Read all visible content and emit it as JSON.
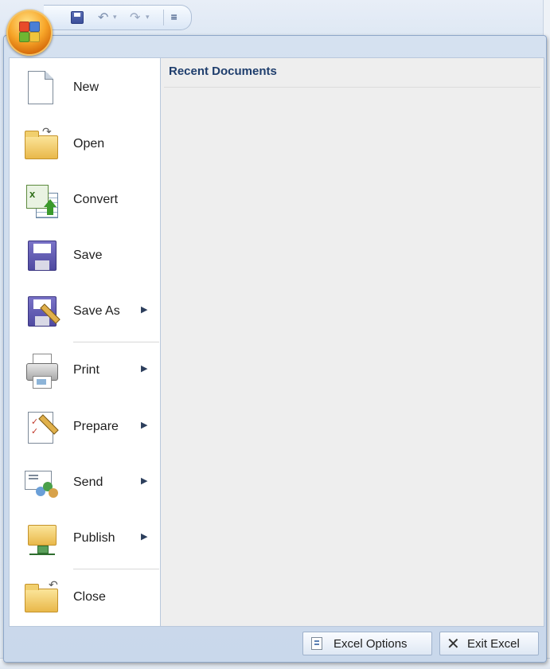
{
  "quick_access": {
    "icons": [
      "save-icon",
      "undo-icon",
      "undo-dropdown-icon",
      "redo-icon",
      "redo-dropdown-icon",
      "customize-toolbar-icon"
    ]
  },
  "office_button": {
    "icon": "office-logo-icon"
  },
  "commands": [
    {
      "label": "New",
      "icon": "new-document-icon",
      "submenu": false
    },
    {
      "label": "Open",
      "icon": "open-folder-icon",
      "submenu": false
    },
    {
      "label": "Convert",
      "icon": "convert-icon",
      "submenu": false
    },
    {
      "label": "Save",
      "icon": "save-disk-icon",
      "submenu": false
    },
    {
      "label": "Save As",
      "icon": "save-as-icon",
      "submenu": true
    },
    {
      "label": "Print",
      "icon": "printer-icon",
      "submenu": true
    },
    {
      "label": "Prepare",
      "icon": "prepare-icon",
      "submenu": true
    },
    {
      "label": "Send",
      "icon": "send-icon",
      "submenu": true
    },
    {
      "label": "Publish",
      "icon": "publish-icon",
      "submenu": true
    },
    {
      "label": "Close",
      "icon": "close-folder-icon",
      "submenu": false
    }
  ],
  "recent": {
    "title": "Recent Documents"
  },
  "footer": {
    "options_label": "Excel Options",
    "exit_label": "Exit Excel"
  },
  "colors": {
    "accent": "#1f3e6d",
    "frame": "#c9d8eb",
    "orb": "#f7a528"
  }
}
